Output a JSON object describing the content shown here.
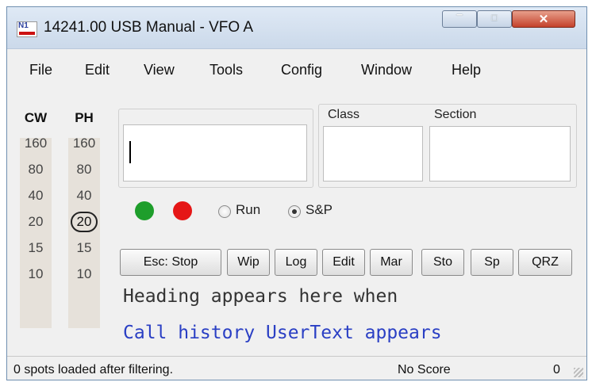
{
  "window": {
    "title": "14241.00 USB Manual - VFO A",
    "logo_text": "N1"
  },
  "menu": [
    "File",
    "Edit",
    "View",
    "Tools",
    "Config",
    "Window",
    "Help"
  ],
  "bands": {
    "cw_header": "CW",
    "ph_header": "PH",
    "cw": [
      "160",
      "80",
      "40",
      "20",
      "15",
      "10"
    ],
    "ph": [
      "160",
      "80",
      "40",
      "20",
      "15",
      "10"
    ],
    "selected_ph": "20"
  },
  "entry": {
    "class_label": "Class",
    "section_label": "Section",
    "call_value": "",
    "class_value": "",
    "section_value": ""
  },
  "indicators": {
    "green_color": "#1e9e2b",
    "red_color": "#e51616"
  },
  "mode": {
    "run_label": "Run",
    "sp_label": "S&P",
    "selected": "S&P"
  },
  "buttons": [
    "Esc: Stop",
    "Wip",
    "Log",
    "Edit",
    "Mar",
    "Sto",
    "Sp",
    "QRZ"
  ],
  "info": {
    "heading_line": "Heading appears here when",
    "history_line": "Call history UserText appears",
    "history_color": "#2a3fc4"
  },
  "status": {
    "spots": "0 spots loaded after filtering.",
    "score": "No Score",
    "count": "0"
  }
}
